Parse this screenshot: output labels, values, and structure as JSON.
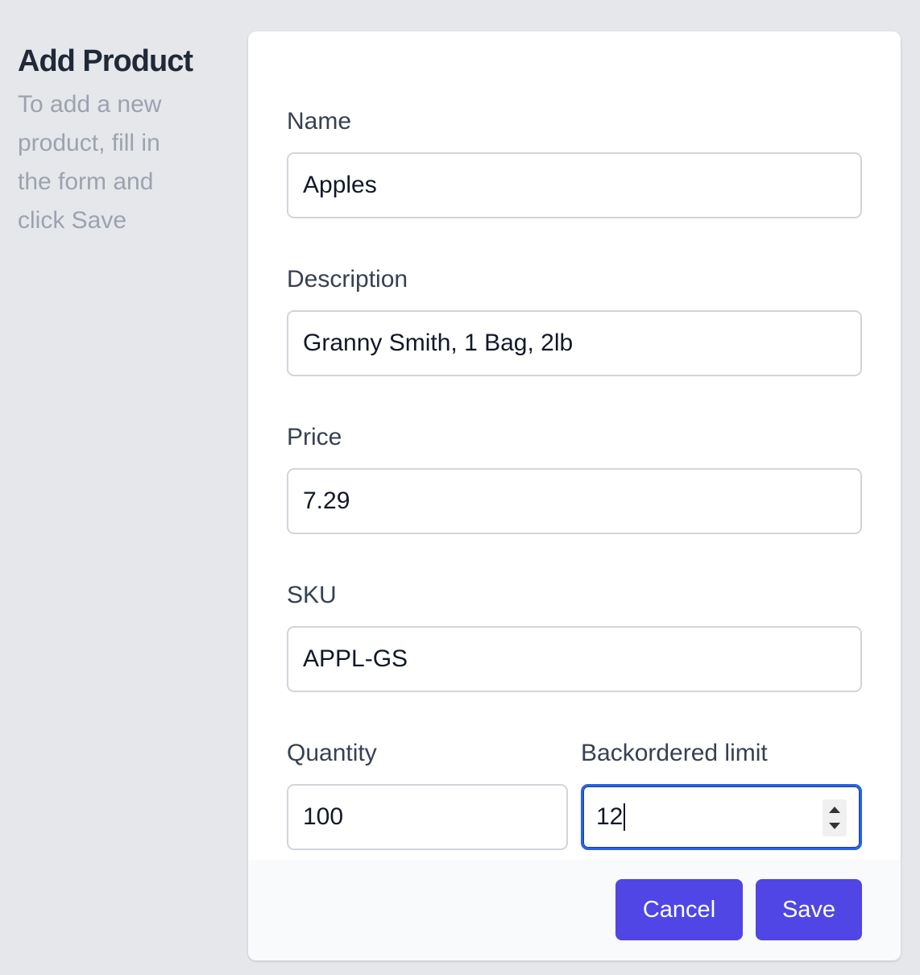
{
  "intro": {
    "title": "Add Product",
    "description": "To add a new product, fill in the form and click Save"
  },
  "form": {
    "name": {
      "label": "Name",
      "value": "Apples"
    },
    "description": {
      "label": "Description",
      "value": "Granny Smith, 1 Bag, 2lb"
    },
    "price": {
      "label": "Price",
      "value": "7.29"
    },
    "sku": {
      "label": "SKU",
      "value": "APPL-GS"
    },
    "quantity": {
      "label": "Quantity",
      "value": "100"
    },
    "backordered_limit": {
      "label": "Backordered limit",
      "value": "12"
    }
  },
  "footer": {
    "cancel_label": "Cancel",
    "save_label": "Save"
  },
  "colors": {
    "page_background": "#e5e7eb",
    "primary_button": "#4f46e5",
    "focus_ring": "#2563eb"
  }
}
